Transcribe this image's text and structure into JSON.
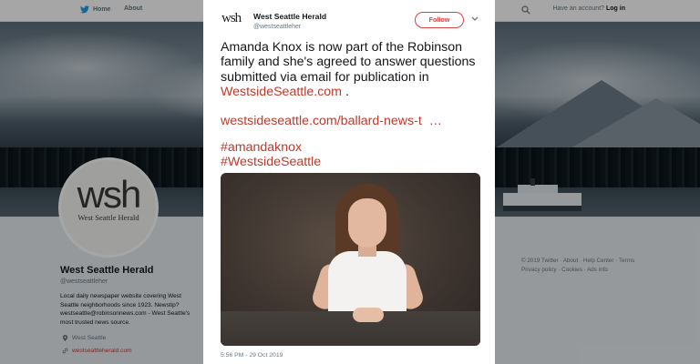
{
  "nav": {
    "home_label": "Home",
    "about_label": "About",
    "account_prompt": "Have an account?",
    "login_label": "Log in"
  },
  "profile": {
    "avatar_logo": "wsh",
    "avatar_subtitle": "West Seattle Herald",
    "name": "West Seattle Herald",
    "handle": "@westseattleher",
    "bio": "Local daily newspaper website covering West Seattle neighborhoods since 1923. Newstip? westseattle@robinsonnews.com - West Seattle's most trusted news source.",
    "location": "West Seattle",
    "website": "westseattleherald.com"
  },
  "footer": {
    "line1": "© 2019 Twitter · About · Help Center · Terms",
    "line2": "Privacy policy · Cookies · Ads info"
  },
  "tweet": {
    "avatar_logo": "wsh",
    "author_name": "West Seattle Herald",
    "author_handle": "@westseattleher",
    "follow_label": "Follow",
    "text_main": "Amanda Knox is now part of the Robinson family and she's agreed to answer questions submitted via email for publication in",
    "text_link": "WestsideSeattle.com",
    "text_end": " .",
    "url": "westsideseattle.com/ballard-news-t",
    "url_ellipsis": "…",
    "hashtag1": "#amandaknox",
    "hashtag2": "#WestsideSeattle",
    "timestamp": "5:56 PM - 29 Oct 2019"
  },
  "colors": {
    "link": "#c0392b",
    "follow": "#d64541",
    "nav_text": "#66757f"
  }
}
